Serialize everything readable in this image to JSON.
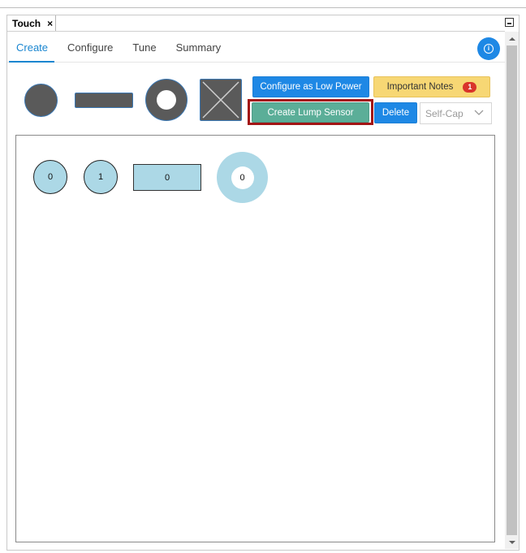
{
  "view": {
    "title": "Touch",
    "close_glyph": "×"
  },
  "nav": {
    "tabs": [
      {
        "label": "Create",
        "active": true
      },
      {
        "label": "Configure"
      },
      {
        "label": "Tune"
      },
      {
        "label": "Summary"
      }
    ]
  },
  "info_button": {
    "glyph": "i"
  },
  "palette": {
    "icons": [
      "button-sensor-icon",
      "slider-sensor-icon",
      "wheel-sensor-icon",
      "surface-sensor-icon"
    ]
  },
  "actions": {
    "low_power_label": "Configure as Low Power",
    "important_notes_label": "Important Notes",
    "important_notes_count": "1",
    "create_lump_label": "Create Lump Sensor",
    "delete_label": "Delete",
    "sensing_mode_value": "Self-Cap"
  },
  "canvas": {
    "buttons": [
      {
        "label": "0"
      },
      {
        "label": "1"
      }
    ],
    "slider": {
      "label": "0"
    },
    "wheel": {
      "label": "0"
    }
  },
  "colors": {
    "accent": "#1e88e5",
    "notes": "#f7d774",
    "lump": "#5bae98",
    "highlight": "#a31515",
    "sensor_fill": "#acd8e6",
    "palette_fill": "#5a5a5a"
  }
}
